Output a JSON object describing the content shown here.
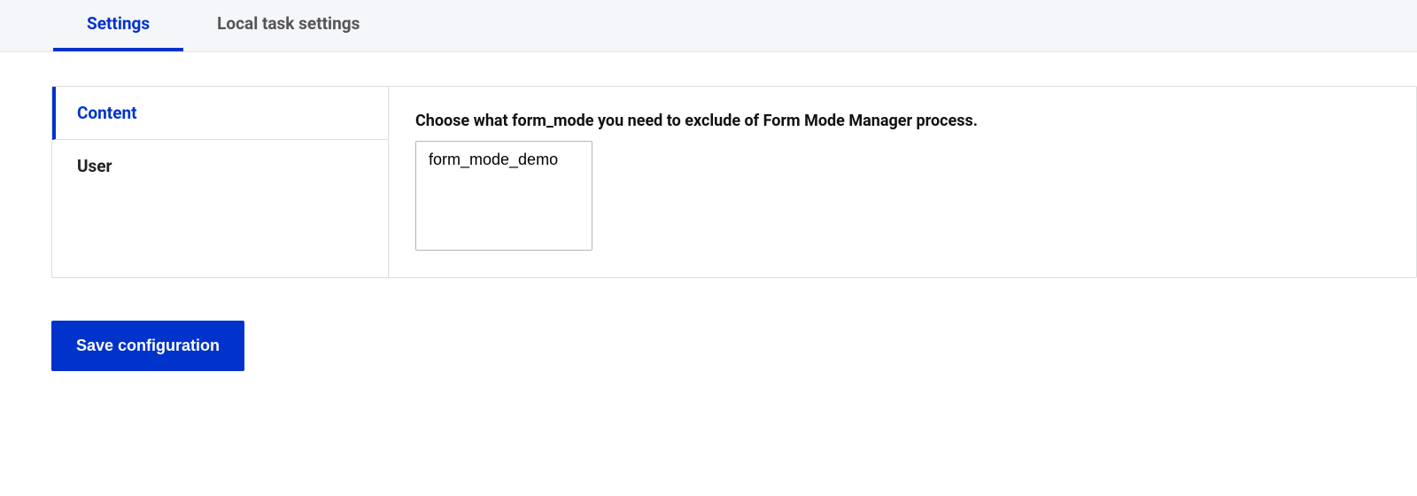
{
  "topTabs": {
    "settings": "Settings",
    "localTaskSettings": "Local task settings"
  },
  "sideTabs": {
    "content": "Content",
    "user": "User"
  },
  "panel": {
    "label": "Choose what form_mode you need to exclude of Form Mode Manager process.",
    "option0": "form_mode_demo"
  },
  "actions": {
    "save": "Save configuration"
  }
}
